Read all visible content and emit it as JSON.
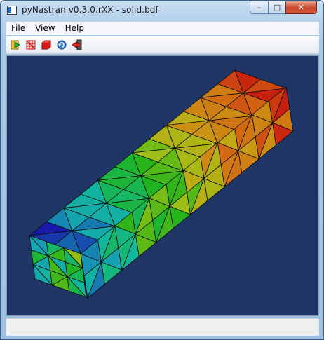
{
  "window": {
    "title": "pyNastran v0.3.0.rXX - solid.bdf"
  },
  "caption_buttons": {
    "minimize": "–",
    "maximize": "□",
    "close": "✕"
  },
  "menu": [
    {
      "mnemonic": "F",
      "rest": "ile"
    },
    {
      "mnemonic": "V",
      "rest": "iew"
    },
    {
      "mnemonic": "H",
      "rest": "elp"
    }
  ],
  "toolbar": {
    "icons": [
      "open-file-icon",
      "wireframe-icon",
      "surface-icon",
      "refresh-icon",
      "exit-icon"
    ]
  },
  "viewport": {
    "background": "#1f3566",
    "colormap": [
      "#1a1aa8",
      "#16a0b4",
      "#12b89a",
      "#1fb41a",
      "#9bbf16",
      "#c8a414",
      "#d26a14",
      "#c8200e"
    ]
  },
  "statusbar": {
    "text": ""
  }
}
